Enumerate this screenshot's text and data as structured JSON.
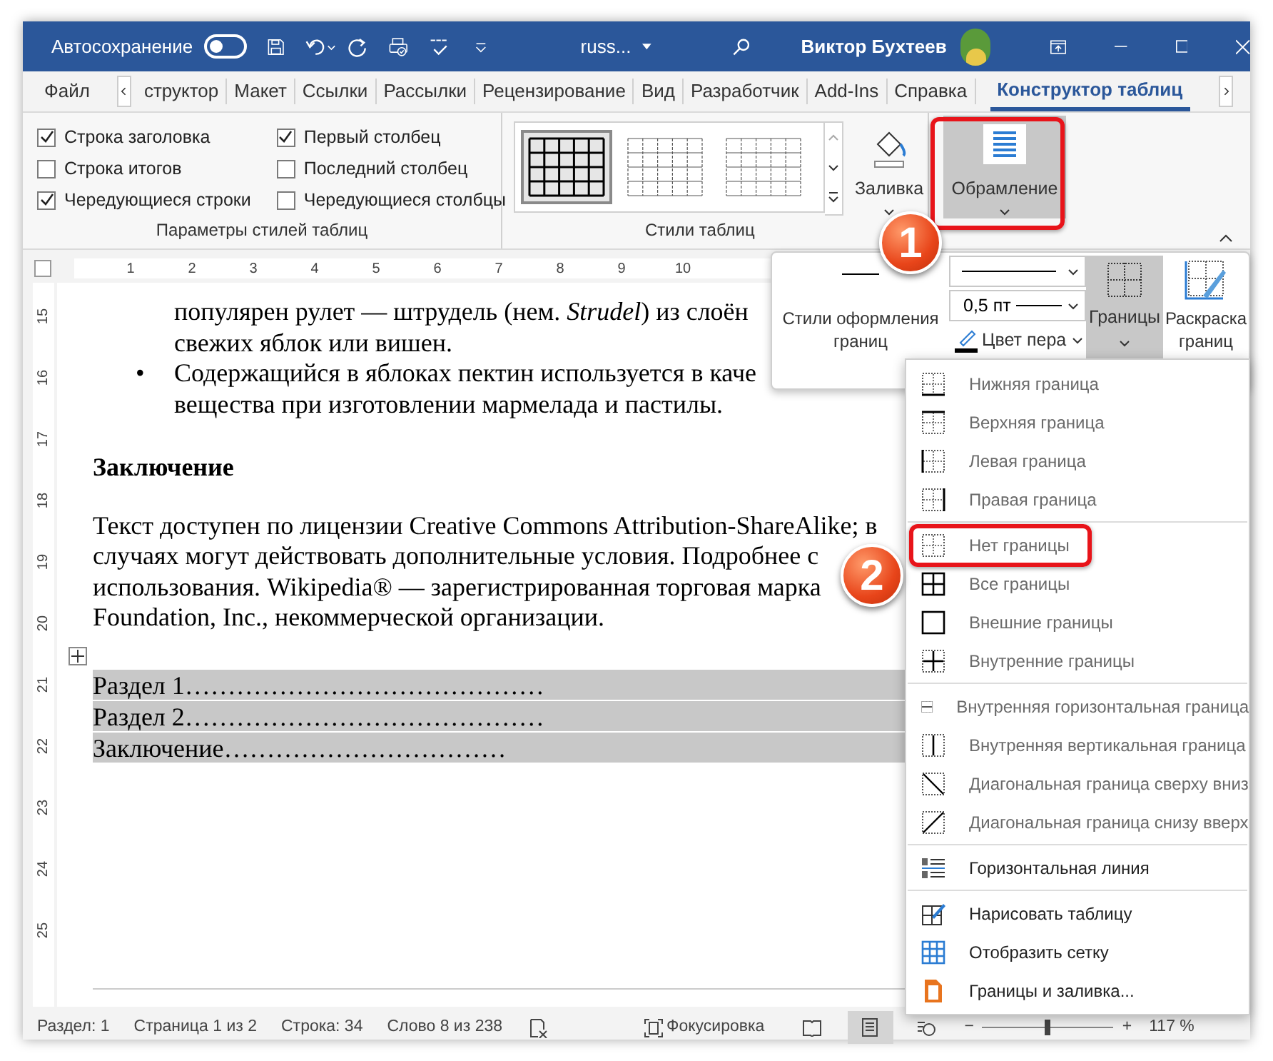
{
  "title_bar": {
    "autosave_label": "Автосохранение",
    "autosave_on": false,
    "filename": "russ...",
    "user": "Виктор Бухтеев"
  },
  "tabs": [
    {
      "label": "Файл",
      "selected": false
    },
    {
      "label": "структор",
      "selected": false
    },
    {
      "label": "Макет",
      "selected": false
    },
    {
      "label": "Ссылки",
      "selected": false
    },
    {
      "label": "Рассылки",
      "selected": false
    },
    {
      "label": "Рецензирование",
      "selected": false
    },
    {
      "label": "Вид",
      "selected": false
    },
    {
      "label": "Разработчик",
      "selected": false
    },
    {
      "label": "Add-Ins",
      "selected": false
    },
    {
      "label": "Справка",
      "selected": false
    },
    {
      "label": "Конструктор таблиц",
      "selected": true
    }
  ],
  "ribbon": {
    "style_options": {
      "title": "Параметры стилей таблиц",
      "options": [
        {
          "label": "Строка заголовка",
          "checked": true
        },
        {
          "label": "Строка итогов",
          "checked": false
        },
        {
          "label": "Чередующиеся строки",
          "checked": true
        },
        {
          "label": "Первый столбец",
          "checked": true
        },
        {
          "label": "Последний столбец",
          "checked": false
        },
        {
          "label": "Чередующиеся столбцы",
          "checked": false
        }
      ]
    },
    "table_styles": {
      "title": "Стили таблиц",
      "styles": [
        {
          "selected": true
        },
        {
          "selected": false
        },
        {
          "selected": false
        }
      ]
    },
    "shading_label": "Заливка",
    "borders_label": "Обрамление",
    "borders_open": true
  },
  "ruler": {
    "h_numbers": [
      "1",
      "2",
      "3",
      "4",
      "5",
      "6",
      "7",
      "8",
      "9",
      "10"
    ],
    "v_numbers": [
      "15",
      "16",
      "17",
      "18",
      "19",
      "20",
      "21",
      "22",
      "23",
      "24",
      "25"
    ]
  },
  "document": {
    "lines": [
      {
        "kind": "text",
        "text": "популярен рулет — штрудель (нем. *Strudel*) из слоён"
      },
      {
        "kind": "text",
        "text": "свежих яблок или вишен."
      },
      {
        "kind": "bullet",
        "bullet": "•",
        "text": "Содержащийся в яблоках пектин используется в каче"
      },
      {
        "kind": "text",
        "text": "вещества при изготовлении мармелада и пастилы."
      }
    ],
    "heading": "Заключение",
    "paragraph_lines": [
      "Текст доступен по лицензии Creative Commons Attribution-ShareAlike; в",
      "случаях могут действовать дополнительные условия. Подробнее с",
      "использования. Wikipedia® — зарегистрированная торговая марка",
      "Foundation, Inc., некоммерческой организации."
    ],
    "toc": [
      "Раздел 1……………………………………",
      "Раздел 2……………………………………",
      "Заключение……………………………"
    ]
  },
  "borders_panel": {
    "styles_label": "Стили оформления границ",
    "weight": "0,5 пт",
    "pen_color_label": "Цвет пера",
    "borders_label": "Границы",
    "borders_open": true,
    "painter_label": "Раскраска границ"
  },
  "borders_menu": [
    {
      "kind": "item",
      "label": "Нижняя граница",
      "disabled": true,
      "outlined": false
    },
    {
      "kind": "item",
      "label": "Верхняя граница",
      "disabled": true,
      "outlined": false
    },
    {
      "kind": "item",
      "label": "Левая граница",
      "disabled": true,
      "outlined": false
    },
    {
      "kind": "item",
      "label": "Правая граница",
      "disabled": true,
      "outlined": false
    },
    {
      "kind": "separator"
    },
    {
      "kind": "item",
      "label": "Нет границы",
      "disabled": true,
      "outlined": true
    },
    {
      "kind": "item",
      "label": "Все границы",
      "disabled": true,
      "outlined": false
    },
    {
      "kind": "item",
      "label": "Внешние границы",
      "disabled": true,
      "outlined": false
    },
    {
      "kind": "item",
      "label": "Внутренние границы",
      "disabled": true,
      "outlined": false
    },
    {
      "kind": "separator"
    },
    {
      "kind": "item",
      "label": "Внутренняя горизонтальная граница",
      "disabled": true,
      "outlined": false
    },
    {
      "kind": "item",
      "label": "Внутренняя вертикальная граница",
      "disabled": true,
      "outlined": false
    },
    {
      "kind": "item",
      "label": "Диагональная граница сверху вниз",
      "disabled": true,
      "outlined": false
    },
    {
      "kind": "item",
      "label": "Диагональная граница снизу вверх",
      "disabled": true,
      "outlined": false
    },
    {
      "kind": "separator"
    },
    {
      "kind": "item",
      "label": "Горизонтальная линия",
      "disabled": false,
      "outlined": false
    },
    {
      "kind": "separator"
    },
    {
      "kind": "item",
      "label": "Нарисовать таблицу",
      "disabled": false,
      "outlined": false
    },
    {
      "kind": "item",
      "label": "Отобразить сетку",
      "disabled": false,
      "outlined": false
    },
    {
      "kind": "item",
      "label": "Границы и заливка...",
      "disabled": false,
      "outlined": false
    }
  ],
  "callouts": [
    "1",
    "2"
  ],
  "status_bar": {
    "section": "Раздел: 1",
    "page": "Страница 1 из 2",
    "line": "Строка: 34",
    "words": "Слово 8 из 238",
    "focus": "Фокусировка",
    "zoom_minus": "−",
    "zoom_plus": "+",
    "zoom_slider": {
      "level": 0.5
    },
    "zoom": "117 %"
  }
}
